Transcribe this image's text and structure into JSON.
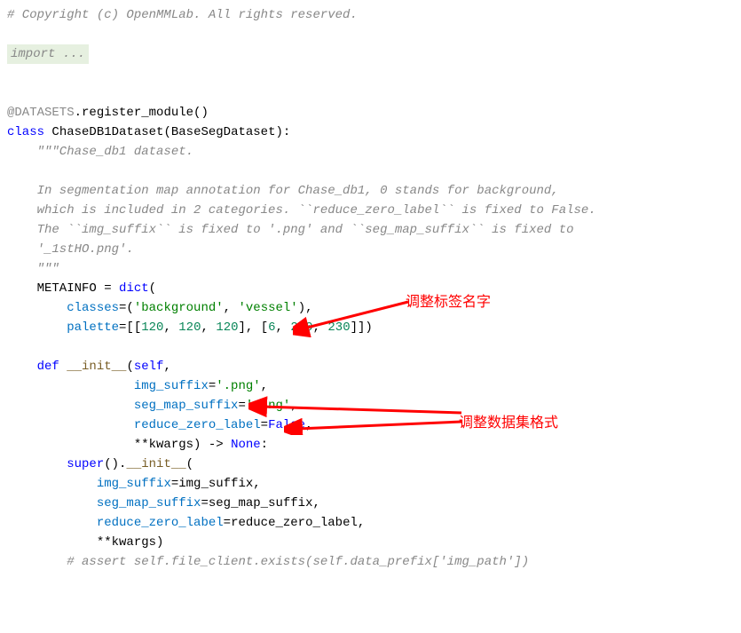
{
  "code": {
    "l1": "# Copyright (c) OpenMMLab. All rights reserved.",
    "l2": "import ...",
    "l3_a": "@DATASETS",
    "l3_b": ".register_module()",
    "l4_class": "class ",
    "l4_name": "ChaseDB1Dataset",
    "l4_paren_open": "(",
    "l4_base": "BaseSegDataset",
    "l4_paren_close": "):",
    "doc1": "    \"\"\"Chase_db1 dataset.",
    "doc2": "    In segmentation map annotation for Chase_db1, 0 stands for background,",
    "doc3": "    which is included in 2 categories. ``reduce_zero_label`` is fixed to False.",
    "doc4": "    The ``img_suffix`` is fixed to '.png' and ``seg_map_suffix`` is fixed to",
    "doc5": "    '_1stHO.png'.",
    "doc6": "    \"\"\"",
    "meta_var": "    METAINFO",
    "meta_eq": " = ",
    "meta_dict": "dict",
    "meta_open": "(",
    "classes_lbl": "        classes",
    "classes_eq": "=(",
    "bg_str": "'background'",
    "comma": ", ",
    "vessel_str": "'vessel'",
    "classes_close": "),",
    "palette_lbl": "        palette",
    "palette_eq": "=[[",
    "n120a": "120",
    "n120b": "120",
    "n120c": "120",
    "pb": "], [",
    "n6": "6",
    "n230a": "230",
    "n230b": "230",
    "palette_close": "]])",
    "def_kw": "    def ",
    "init_name": "__init__",
    "def_open": "(",
    "self_p": "self",
    "commap": ",",
    "indent_param": "                 ",
    "img_suffix_p": "img_suffix",
    "eq": "=",
    "png1": "'.png'",
    "seg_map_suffix_p": "seg_map_suffix",
    "png2": "'.png'",
    "reduce_zero_p": "reduce_zero_label",
    "false_v": "False",
    "kwargs_p": "**kwargs",
    "arrow": ") -> ",
    "none_v": "None",
    "colon": ":",
    "super_indent": "        ",
    "super_call": "super",
    "super_open": "().",
    "super_init": "__init__",
    "super_paren": "(",
    "arg_indent": "            ",
    "img_suffix_arg": "img_suffix",
    "img_suffix_val": "img_suffix,",
    "seg_map_arg": "seg_map_suffix",
    "seg_map_val": "seg_map_suffix,",
    "reduce_arg": "reduce_zero_label",
    "reduce_val": "reduce_zero_label,",
    "kwargs_arg": "**kwargs)",
    "assert_comment": "        # assert self.file_client.exists(self.data_prefix['img_path'])"
  },
  "annotations": {
    "label1": "调整标签名字",
    "label2": "调整数据集格式"
  }
}
